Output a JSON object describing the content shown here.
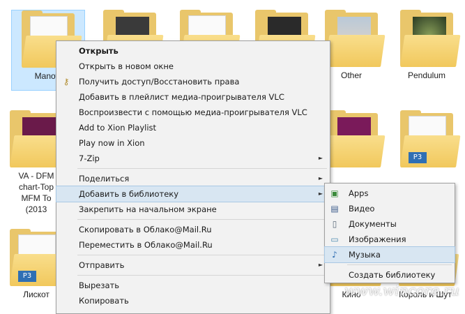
{
  "desktop": {
    "items": [
      {
        "label": "Manow"
      },
      {
        "label": ""
      },
      {
        "label": ""
      },
      {
        "label": ""
      },
      {
        "label": "Other"
      },
      {
        "label": "Pendulum"
      },
      {
        "label": "VA - DFM"
      },
      {
        "label": "chart-Top"
      },
      {
        "label": "MFM To"
      },
      {
        "label": "(2013"
      },
      {
        "label": "Лиcкот"
      },
      {
        "label": "Кино"
      },
      {
        "label": "Король и Шут"
      }
    ],
    "badge": "P3"
  },
  "context_menu": {
    "items": [
      {
        "label": "Открыть"
      },
      {
        "label": "Открыть в новом окне"
      },
      {
        "label": "Получить доступ/Восстановить права"
      },
      {
        "label": "Добавить в плейлист медиа-проигрывателя VLC"
      },
      {
        "label": "Воспроизвести с помощью медиа-проигрывателя VLC"
      },
      {
        "label": "Add to Xion Playlist"
      },
      {
        "label": "Play now in Xion"
      },
      {
        "label": "7-Zip"
      },
      {
        "label": "Поделиться"
      },
      {
        "label": "Добавить в библиотеку"
      },
      {
        "label": "Закрепить на начальном экране"
      },
      {
        "label": "Скопировать в Облако@Mail.Ru"
      },
      {
        "label": "Переместить в Облако@Mail.Ru"
      },
      {
        "label": "Отправить"
      },
      {
        "label": "Вырезать"
      },
      {
        "label": "Копировать"
      }
    ],
    "submenu_arrow": "►"
  },
  "library_submenu": {
    "items": [
      {
        "label": "Apps"
      },
      {
        "label": "Видео"
      },
      {
        "label": "Документы"
      },
      {
        "label": "Изображения"
      },
      {
        "label": "Музыка"
      },
      {
        "label": "Создать библиотеку"
      }
    ]
  },
  "watermark": "www.wincore.ru",
  "colors": {
    "selection": "#cce8ff",
    "menu_bg": "#f2f2f2",
    "menu_hover": "#d8e6f2",
    "folder": "#f1c85c"
  }
}
